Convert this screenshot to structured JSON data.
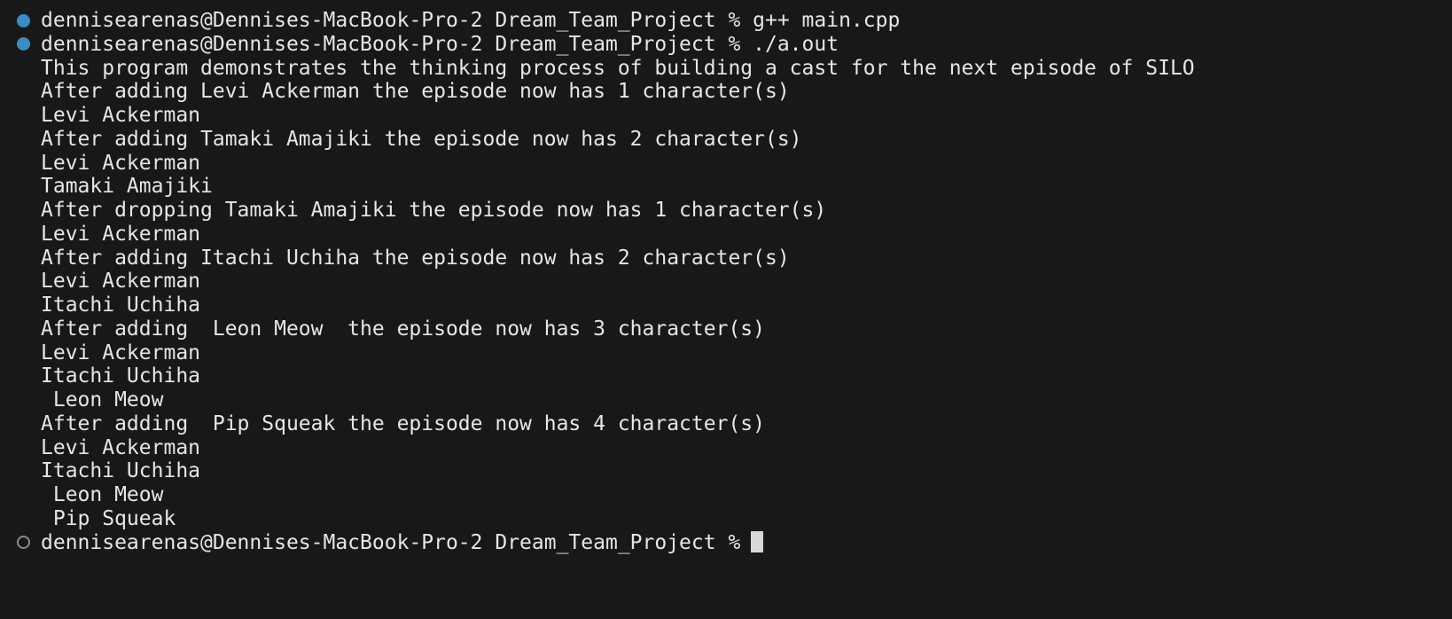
{
  "terminal": {
    "lines": [
      {
        "text": "dennisearenas@Dennises-MacBook-Pro-2 Dream_Team_Project % g++ main.cpp",
        "marker": "filled"
      },
      {
        "text": "dennisearenas@Dennises-MacBook-Pro-2 Dream_Team_Project % ./a.out",
        "marker": "filled"
      },
      {
        "text": "This program demonstrates the thinking process of building a cast for the next episode of SILO"
      },
      {
        "text": "After adding Levi Ackerman the episode now has 1 character(s)"
      },
      {
        "text": "Levi Ackerman"
      },
      {
        "text": "After adding Tamaki Amajiki the episode now has 2 character(s)"
      },
      {
        "text": "Levi Ackerman"
      },
      {
        "text": "Tamaki Amajiki"
      },
      {
        "text": "After dropping Tamaki Amajiki the episode now has 1 character(s)"
      },
      {
        "text": "Levi Ackerman"
      },
      {
        "text": "After adding Itachi Uchiha the episode now has 2 character(s)"
      },
      {
        "text": "Levi Ackerman"
      },
      {
        "text": "Itachi Uchiha"
      },
      {
        "text": "After adding  Leon Meow  the episode now has 3 character(s)"
      },
      {
        "text": "Levi Ackerman"
      },
      {
        "text": "Itachi Uchiha"
      },
      {
        "text": " Leon Meow"
      },
      {
        "text": "After adding  Pip Squeak the episode now has 4 character(s)"
      },
      {
        "text": "Levi Ackerman"
      },
      {
        "text": "Itachi Uchiha"
      },
      {
        "text": " Leon Meow"
      },
      {
        "text": " Pip Squeak"
      },
      {
        "text": "dennisearenas@Dennises-MacBook-Pro-2 Dream_Team_Project %",
        "marker": "hollow",
        "cursor": true
      }
    ],
    "colors": {
      "background": "#181818",
      "text": "#e6e6e6",
      "success_marker": "#3b8cc2",
      "idle_marker": "#8a8a8a",
      "cursor": "#d8d8d8"
    }
  }
}
